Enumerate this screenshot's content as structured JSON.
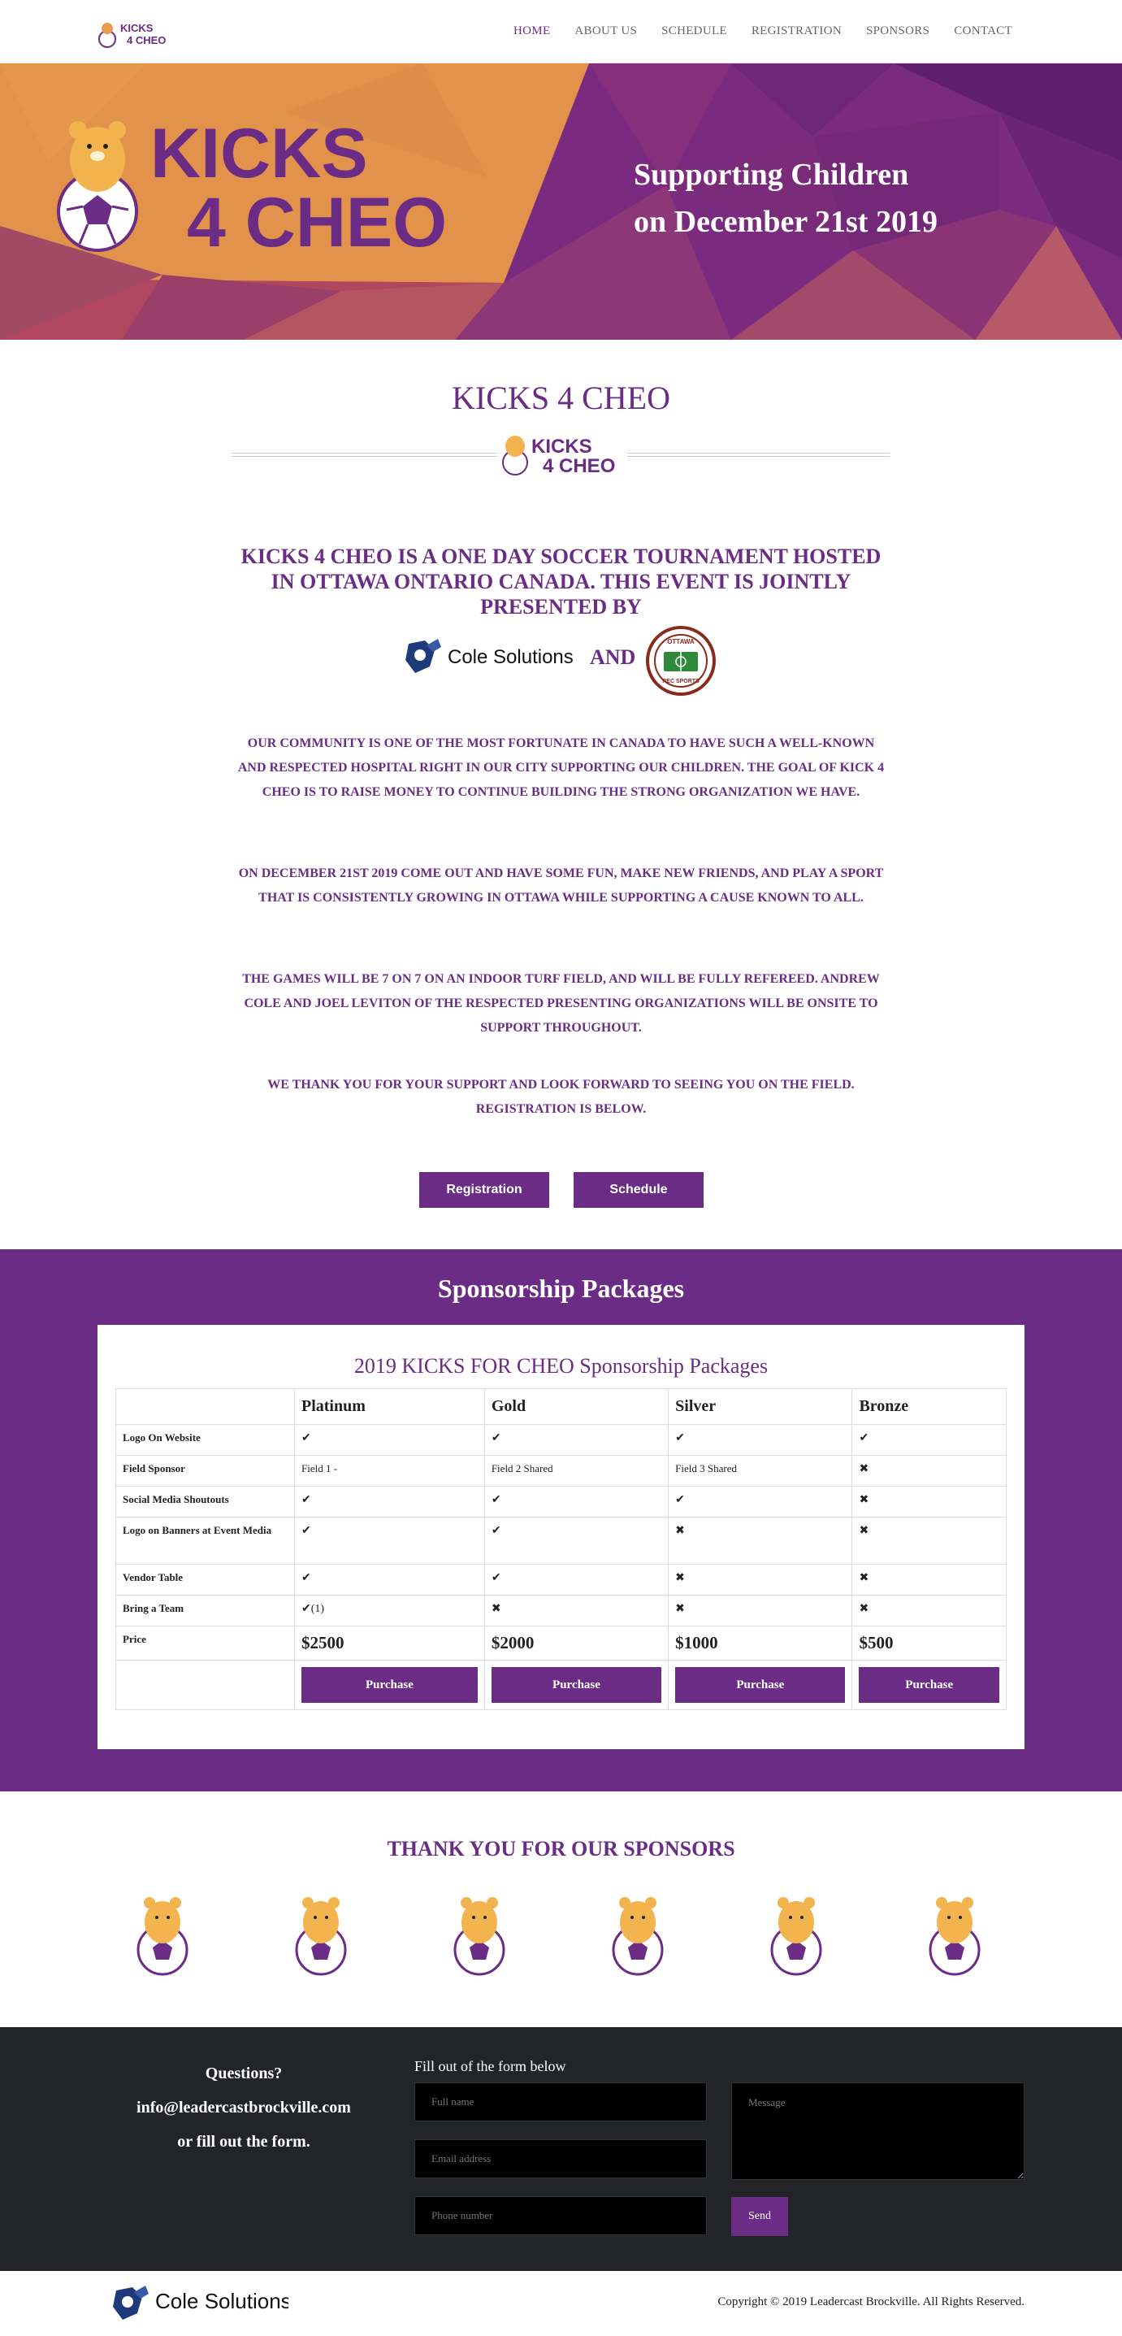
{
  "colors": {
    "brand": "#6a2c85",
    "orange": "#e89c4c",
    "dark": "#222428"
  },
  "nav": {
    "logo_text_1": "KICKS",
    "logo_text_2": "4 CHEO",
    "items": [
      "HOME",
      "ABOUT US",
      "SCHEDULE",
      "REGISTRATION",
      "SPONSORS",
      "CONTACT"
    ]
  },
  "hero": {
    "logo_line_1": "KICKS",
    "logo_line_2": "4 CHEO",
    "tag_line_1": "Supporting Children",
    "tag_line_2": "on December 21st 2019"
  },
  "main": {
    "title": "KICKS 4 CHEO",
    "title_logo_1": "KICKS",
    "title_logo_2": "4 CHEO",
    "intro": "KICKS 4 CHEO IS A ONE DAY SOCCER TOURNAMENT HOSTED IN OTTAWA ONTARIO CANADA. THIS EVENT IS JOINTLY PRESENTED BY",
    "cole_name": "Cole Solutions",
    "and": "AND",
    "orec_text_top": "OTTAWA",
    "orec_text_bottom": "REC SPORTS",
    "paragraphs": [
      "OUR COMMUNITY IS ONE OF THE MOST FORTUNATE IN CANADA TO HAVE SUCH A WELL-KNOWN AND RESPECTED HOSPITAL RIGHT IN OUR CITY SUPPORTING OUR CHILDREN. THE GOAL OF KICK 4 CHEO IS TO RAISE MONEY TO CONTINUE BUILDING THE STRONG ORGANIZATION WE HAVE.",
      "ON DECEMBER 21ST 2019 COME OUT AND HAVE SOME FUN, MAKE NEW FRIENDS, AND PLAY A SPORT THAT IS CONSISTENTLY GROWING IN OTTAWA WHILE SUPPORTING A CAUSE KNOWN TO ALL.",
      "THE GAMES WILL BE 7 ON 7 ON AN INDOOR TURF FIELD, AND WILL BE FULLY REFEREED. ANDREW COLE AND JOEL LEVITON OF THE RESPECTED PRESENTING ORGANIZATIONS WILL BE ONSITE TO SUPPORT THROUGHOUT.",
      "WE THANK YOU FOR YOUR SUPPORT AND LOOK FORWARD TO SEEING YOU ON THE FIELD. REGISTRATION IS BELOW."
    ],
    "btn_registration": "Registration",
    "btn_schedule": "Schedule"
  },
  "packages": {
    "title": "Sponsorship Packages",
    "subtitle": "2019 KICKS FOR CHEO Sponsorship Packages",
    "columns": [
      "Platinum",
      "Gold",
      "Silver",
      "Bronze"
    ],
    "rows": [
      {
        "label": "Logo On Website",
        "cells": [
          "✔",
          "✔",
          "✔",
          "✔"
        ]
      },
      {
        "label": "Field Sponsor",
        "cells": [
          "Field 1 -",
          "Field 2 Shared",
          "Field 3 Shared",
          "✖"
        ]
      },
      {
        "label": "Social Media Shoutouts",
        "cells": [
          "✔",
          "✔",
          "✔",
          "✖"
        ]
      },
      {
        "label": "Logo on Banners at Event Media",
        "cells": [
          "✔",
          "✔",
          "✖",
          "✖"
        ]
      },
      {
        "label": "Vendor Table",
        "cells": [
          "✔",
          "✔",
          "✖",
          "✖"
        ]
      },
      {
        "label": "Bring a Team",
        "cells": [
          "✔(1)",
          "✖",
          "✖",
          "✖"
        ]
      }
    ],
    "price_label": "Price",
    "prices": [
      "$2500",
      "$2000",
      "$1000",
      "$500"
    ],
    "purchase": "Purchase"
  },
  "thanks": {
    "title": "THANK YOU FOR OUR SPONSORS"
  },
  "footer": {
    "q1": "Questions?",
    "q2": "info@leadercastbrockville.com",
    "q3": "or fill out the form.",
    "form_heading": "Fill out of the form below",
    "ph_name": "Full name",
    "ph_email": "Email address",
    "ph_phone": "Phone number",
    "ph_message": "Message",
    "send": "Send"
  },
  "bottom": {
    "cole_name": "Cole Solutions",
    "copyright": "Copyright © 2019 Leadercast Brockville. All Rights Reserved."
  }
}
